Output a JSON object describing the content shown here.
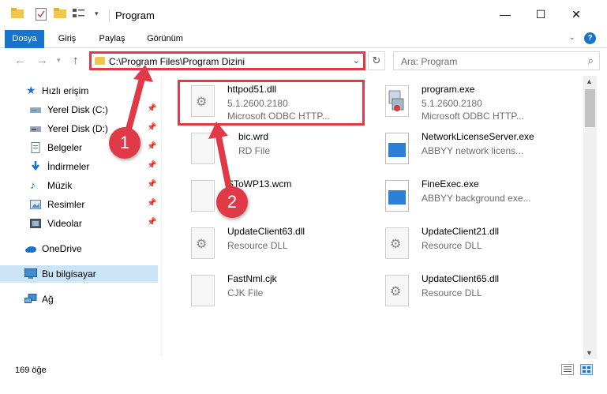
{
  "window": {
    "title": "Program",
    "minimize": "—",
    "maximize": "☐",
    "close": "✕"
  },
  "ribbon": {
    "tabs": [
      "Dosya",
      "Giriş",
      "Paylaş",
      "Görünüm"
    ],
    "help": "?"
  },
  "nav": {
    "address": "C:\\Program Files\\Program Dizini",
    "search_placeholder": "Ara: Program"
  },
  "sidebar": {
    "items": [
      {
        "label": "Hızlı erişim",
        "icon": "star-icon"
      },
      {
        "label": "Yerel Disk (C:)",
        "icon": "drive-icon",
        "pinned": true
      },
      {
        "label": "Yerel Disk (D:)",
        "icon": "drive-icon",
        "pinned": true
      },
      {
        "label": "Belgeler",
        "icon": "documents-icon",
        "pinned": true
      },
      {
        "label": "İndirmeler",
        "icon": "download-icon",
        "pinned": true
      },
      {
        "label": "Müzik",
        "icon": "music-icon",
        "pinned": true
      },
      {
        "label": "Resimler",
        "icon": "pictures-icon",
        "pinned": true
      },
      {
        "label": "Videolar",
        "icon": "videos-icon",
        "pinned": true
      },
      {
        "label": "OneDrive",
        "icon": "cloud-icon"
      },
      {
        "label": "Bu bilgisayar",
        "icon": "computer-icon",
        "selected": true
      },
      {
        "label": "Ağ",
        "icon": "network-icon"
      }
    ]
  },
  "files_left": [
    {
      "name": "httpod51.dll",
      "line2": "5.1.2600.2180",
      "line3": "Microsoft ODBC HTTP...",
      "icon": "gear-file-icon"
    },
    {
      "name": "bic.wrd",
      "line2": "RD File",
      "line3": "",
      "icon": "blank-file-icon"
    },
    {
      "name": "SToWP13.wcm",
      "line2": "",
      "line3": "",
      "icon": "blank-file-icon"
    },
    {
      "name": "UpdateClient63.dll",
      "line2": "Resource DLL",
      "line3": "",
      "icon": "gear-file-icon"
    },
    {
      "name": "FastNml.cjk",
      "line2": "CJK File",
      "line3": "",
      "icon": "blank-file-icon"
    }
  ],
  "files_right": [
    {
      "name": "program.exe",
      "line2": "5.1.2600.2180",
      "line3": "Microsoft ODBC HTTP...",
      "icon": "exe-icon"
    },
    {
      "name": "NetworkLicenseServer.exe",
      "line2": "ABBYY network licens...",
      "line3": "",
      "icon": "app-icon"
    },
    {
      "name": "FineExec.exe",
      "line2": "ABBYY background exe...",
      "line3": "",
      "icon": "app-icon"
    },
    {
      "name": "UpdateClient21.dll",
      "line2": "Resource DLL",
      "line3": "",
      "icon": "gear-file-icon"
    },
    {
      "name": "UpdateClient65.dll",
      "line2": "Resource DLL",
      "line3": "",
      "icon": "gear-file-icon"
    }
  ],
  "annotations": {
    "step1": "1",
    "step2": "2"
  },
  "status": {
    "item_count": "169 öğe"
  },
  "colors": {
    "accent": "#1a73c9",
    "highlight": "#e03a48",
    "selected_bg": "#cce4f7"
  }
}
